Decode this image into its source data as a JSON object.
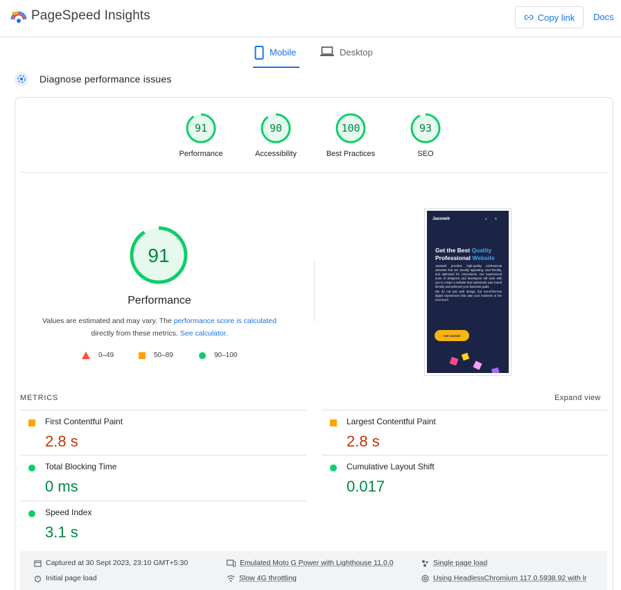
{
  "header": {
    "brand": "PageSpeed Insights",
    "copy_link": "Copy link",
    "docs": "Docs"
  },
  "tabs": [
    {
      "label": "Mobile",
      "active": true
    },
    {
      "label": "Desktop",
      "active": false
    }
  ],
  "diagnose_title": "Diagnose performance issues",
  "scores": [
    {
      "value": "91",
      "label": "Performance",
      "color": "#0cce6b"
    },
    {
      "value": "90",
      "label": "Accessibility",
      "color": "#0cce6b"
    },
    {
      "value": "100",
      "label": "Best Practices",
      "color": "#0cce6b"
    },
    {
      "value": "93",
      "label": "SEO",
      "color": "#0cce6b"
    }
  ],
  "main_score": {
    "value": "91",
    "label": "Performance"
  },
  "description": {
    "part1": "Values are estimated and may vary. The ",
    "link1": "performance score is calculated",
    "part2": "directly from these metrics. ",
    "link2": "See calculator",
    "part3": "."
  },
  "legend": [
    {
      "range": "0–49",
      "shape": "triangle",
      "color": "#ff4e42"
    },
    {
      "range": "50–89",
      "shape": "square",
      "color": "#ffa400"
    },
    {
      "range": "90–100",
      "shape": "circle",
      "color": "#0cce6b"
    }
  ],
  "screenshot": {
    "logo_text": "Jassweb",
    "heading_1": "Get the Best ",
    "heading_q": "Quality",
    "heading_2": "Professional ",
    "heading_w": "Website",
    "paragraph_1": "Jassweb provides high-quality professional websites that are visually appealing, user-friendly, and optimized for conversions. Our experienced team of designers and developers will work with you to create a website that represents your brand identity and achieves your business goals.",
    "paragraph_2": "We do not just web design, but out-of-the-box digital experiences that take your business to the next level!",
    "button": "Get started"
  },
  "metrics": {
    "title": "METRICS",
    "expand": "Expand view",
    "items": [
      {
        "name": "First Contentful Paint",
        "value": "2.8 s",
        "status": "average"
      },
      {
        "name": "Largest Contentful Paint",
        "value": "2.8 s",
        "status": "average"
      },
      {
        "name": "Total Blocking Time",
        "value": "0 ms",
        "status": "good"
      },
      {
        "name": "Cumulative Layout Shift",
        "value": "0.017",
        "status": "good"
      },
      {
        "name": "Speed Index",
        "value": "3.1 s",
        "status": "good"
      }
    ]
  },
  "footer": {
    "captured": "Captured at 30 Sept 2023, 23:10 GMT+5:30",
    "initial": "Initial page load",
    "device": "Emulated Moto G Power with Lighthouse 11.0.0",
    "throttle": "Slow 4G throttling",
    "single": "Single page load",
    "browser": "Using HeadlessChromium 117.0.5938.92 with lr"
  }
}
